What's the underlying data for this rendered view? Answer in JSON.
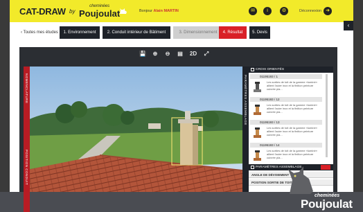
{
  "header": {
    "app_name": "CAT-DRAW",
    "by": "by",
    "brand_small": "cheminées",
    "brand_big": "Poujoulat",
    "greeting": "Bonjour",
    "user_name": "Alain MARTIN",
    "logout": "Déconnexion",
    "accent_color": "#f2ea2a"
  },
  "nav": {
    "back_label": "Toutes mes études",
    "steps": [
      {
        "label": "1. Environnement",
        "state": "done"
      },
      {
        "label": "2. Conduit intérieur de Bâtiment",
        "state": "done"
      },
      {
        "label": "3. Dimensionnement",
        "state": "disabled"
      },
      {
        "label": "4. Résultat",
        "state": "active"
      },
      {
        "label": "5. Devis",
        "state": "done"
      }
    ]
  },
  "viewer": {
    "toolbar": [
      "save-icon",
      "zoom-in-icon",
      "zoom-out-icon",
      "list-icon",
      "2D",
      "expand-icon"
    ],
    "view_mode": "2D",
    "left_strip_top": "NOMENCLATURE",
    "left_strip_bottom": "POSITION CONDUIT"
  },
  "panel": {
    "section_title": "CROIX ORIENTÉS",
    "vertical_label": "PARAMÈTRES ASSEMBLAGE",
    "items": [
      {
        "code": "01195193 / 1",
        "desc": "Les sorties de toit de la gamme «luminé» allient l'acier inox et la finition peinture cuivrée pla..."
      },
      {
        "code": "01195193 / 12",
        "desc": "Les sorties de toit de la gamme «luminé» allient l'acier inox et la finition peinture cuivrée pla..."
      },
      {
        "code": "01195193 / 13",
        "desc": "Les sorties de toit de la gamme «luminé» allient l'acier inox et la finition peinture cuivrée pla..."
      },
      {
        "code": "01195193 / 14",
        "desc": "Les sorties de toit de la gamme «luminé» allient l'acier inox et la finition peinture cuivrée pla..."
      }
    ],
    "footer_title": "PARAMÈTRES ASSEMBLAGE",
    "params": [
      "ANGLE DE DÉVOIEMENT",
      "POSITION SORTIE DE TOIT"
    ]
  },
  "brand_corner": {
    "small": "cheminées",
    "big": "Poujoulat"
  }
}
